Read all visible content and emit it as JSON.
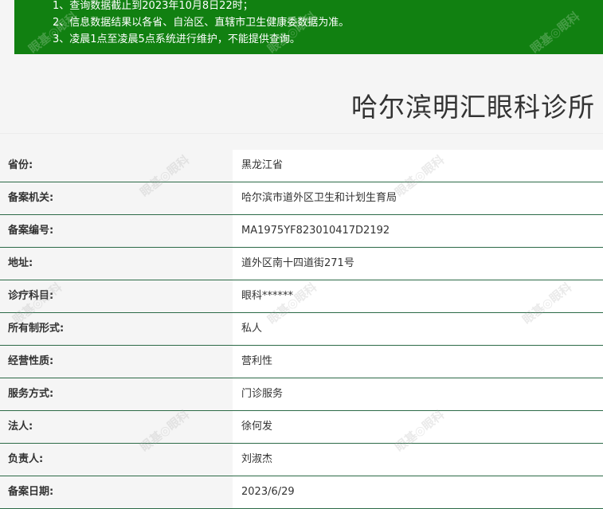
{
  "notice": {
    "lines": [
      "1、查询数据截止到2023年10月8日22时；",
      "2、信息数据结果以各省、自治区、直辖市卫生健康委数据为准。",
      "3、凌晨1点至凌晨5点系统进行维护，不能提供查询。"
    ]
  },
  "clinic": {
    "title": "哈尔滨明汇眼科诊所"
  },
  "fields": [
    {
      "label": "省份:",
      "value": "黑龙江省"
    },
    {
      "label": "备案机关:",
      "value": "哈尔滨市道外区卫生和计划生育局"
    },
    {
      "label": "备案编号:",
      "value": "MA1975YF823010417D2192"
    },
    {
      "label": "地址:",
      "value": "道外区南十四道街271号"
    },
    {
      "label": "诊疗科目:",
      "value": "眼科******"
    },
    {
      "label": "所有制形式:",
      "value": "私人"
    },
    {
      "label": "经营性质:",
      "value": "营利性"
    },
    {
      "label": "服务方式:",
      "value": "门诊服务"
    },
    {
      "label": "法人:",
      "value": "徐何发"
    },
    {
      "label": "负责人:",
      "value": "刘淑杰"
    },
    {
      "label": "备案日期:",
      "value": "2023/6/29"
    }
  ],
  "watermark": {
    "text": "眼基◎眼科"
  },
  "colors": {
    "notice_bg": "#118011",
    "row_divider": "#2c6a47",
    "page_bg": "#f5f5f5"
  }
}
